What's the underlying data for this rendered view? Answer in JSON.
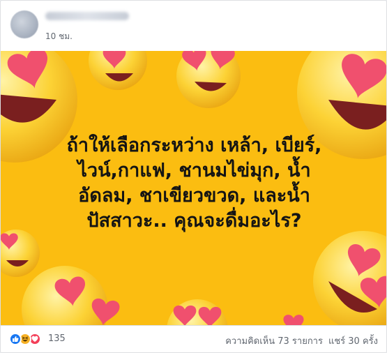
{
  "post": {
    "author_name": "",
    "timestamp": "10 ชม.",
    "image_text": "ถ้าให้เลือกระหว่าง เหล้า, เบียร์,\nไวน์,กาแฟ, ชานมไข่มุก, น้ำ\nอัดลม, ชาเขียวขวด, และน้ำ\nปัสสาวะ.. คุณจะดื่มอะไร?",
    "image_background": "#fbbd11"
  },
  "footer": {
    "reactions": [
      "like-icon",
      "haha-icon",
      "love-icon"
    ],
    "reaction_count": "135",
    "comments": "ความคิดเห็น 73 รายการ",
    "shares": "แชร์ 30 ครั้ง"
  },
  "colors": {
    "like": "#1877f2",
    "haha": "#f7b125",
    "love": "#f33e58",
    "emoji_face": "#fcd34d",
    "emoji_heart": "#f0506e"
  }
}
